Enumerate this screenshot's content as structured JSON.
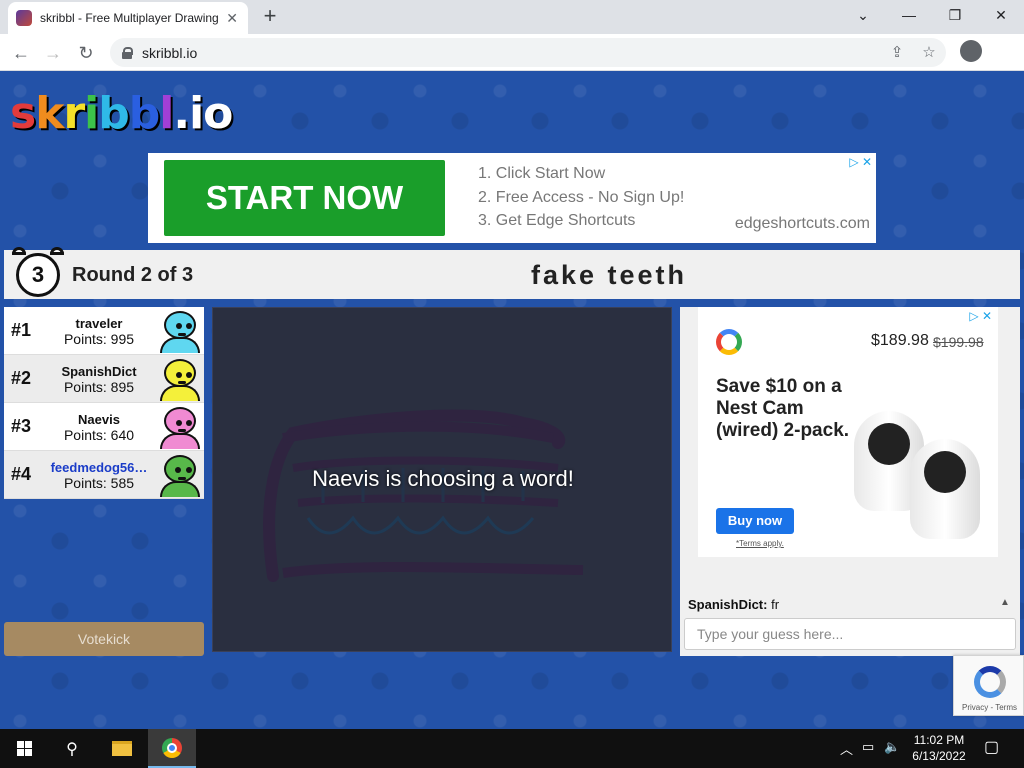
{
  "browser": {
    "tab_title": "skribbl - Free Multiplayer Drawing",
    "url": "skribbl.io",
    "new_tab": "+",
    "tab_close": "✕",
    "minimize": "—",
    "restore": "❐",
    "close": "✕",
    "back": "←",
    "forward": "→",
    "reload": "↻",
    "share": "⇪",
    "star": "☆",
    "kebab": "⋮"
  },
  "logo": {
    "letters": [
      "s",
      "k",
      "r",
      "i",
      "b",
      "b",
      "l",
      ".",
      "i",
      "o"
    ],
    "colors": [
      "#e23b3b",
      "#f08c1e",
      "#f5e02a",
      "#3cc24a",
      "#2fb9e8",
      "#2a5fe0",
      "#a23fd6",
      "#ffffff",
      "#ffffff",
      "#ffffff"
    ]
  },
  "ad_top": {
    "cta": "START NOW",
    "steps": [
      "1.   Click Start Now",
      "2.   Free Access - No Sign Up!",
      "3.   Get Edge Shortcuts"
    ],
    "domain": "edgeshortcuts.com"
  },
  "game": {
    "timer": "3",
    "round": "Round 2 of 3",
    "word": "fake teeth",
    "canvas_message": "Naevis is choosing a word!",
    "votekick": "Votekick"
  },
  "players": [
    {
      "rank": "#1",
      "name": "traveler",
      "points": "Points: 995",
      "color": "#5fd7f0",
      "me": false
    },
    {
      "rank": "#2",
      "name": "SpanishDict",
      "points": "Points: 895",
      "color": "#f4f03a",
      "me": false
    },
    {
      "rank": "#3",
      "name": "Naevis",
      "points": "Points: 640",
      "color": "#f08ad2",
      "me": false
    },
    {
      "rank": "#4",
      "name": "feedmedog56…",
      "points": "Points: 585",
      "color": "#58b84a",
      "me": true
    }
  ],
  "ad_side": {
    "price": "$189.98",
    "old_price": "$199.98",
    "headline": "Save $10 on a Nest Cam (wired) 2-pack.",
    "button": "Buy now",
    "terms": "*Terms apply."
  },
  "chat": {
    "messages": [
      {
        "user": "SpanishDict:",
        "text": " fr"
      }
    ],
    "placeholder": "Type your guess here..."
  },
  "recaptcha": {
    "text": "Privacy - Terms"
  },
  "taskbar": {
    "time": "11:02 PM",
    "date": "6/13/2022"
  }
}
